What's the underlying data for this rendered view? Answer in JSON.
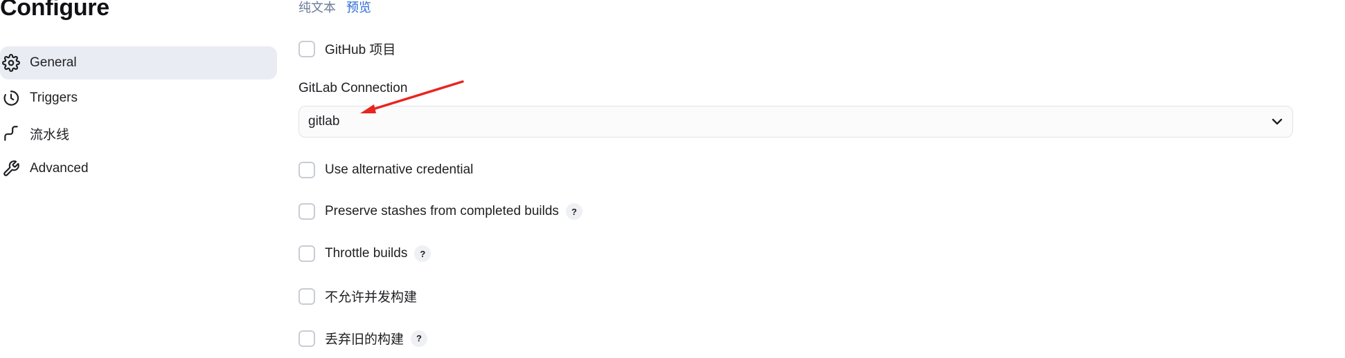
{
  "page_title": "Configure",
  "sidebar": {
    "items": [
      {
        "label": "General",
        "icon": "gear-icon",
        "active": true
      },
      {
        "label": "Triggers",
        "icon": "clock-icon",
        "active": false
      },
      {
        "label": "流水线",
        "icon": "pipeline-icon",
        "active": false
      },
      {
        "label": "Advanced",
        "icon": "wrench-icon",
        "active": false
      }
    ]
  },
  "main": {
    "format_links": {
      "plain_text": "纯文本",
      "preview": "预览"
    },
    "github_project": {
      "label": "GitHub 项目",
      "checked": false
    },
    "gitlab_connection": {
      "label": "GitLab Connection",
      "selected": "gitlab"
    },
    "options": [
      {
        "label": "Use alternative credential",
        "checked": false,
        "help": false
      },
      {
        "label": "Preserve stashes from completed builds",
        "checked": false,
        "help": true
      },
      {
        "label": "Throttle builds",
        "checked": false,
        "help": true
      },
      {
        "label": "不允许并发构建",
        "checked": false,
        "help": false
      },
      {
        "label": "丢弃旧的构建",
        "checked": false,
        "help": true
      }
    ],
    "help_glyph": "?"
  },
  "colors": {
    "active_bg": "#e9ecf2",
    "link": "#2c6bd9",
    "annotation_arrow": "#e8251f"
  }
}
